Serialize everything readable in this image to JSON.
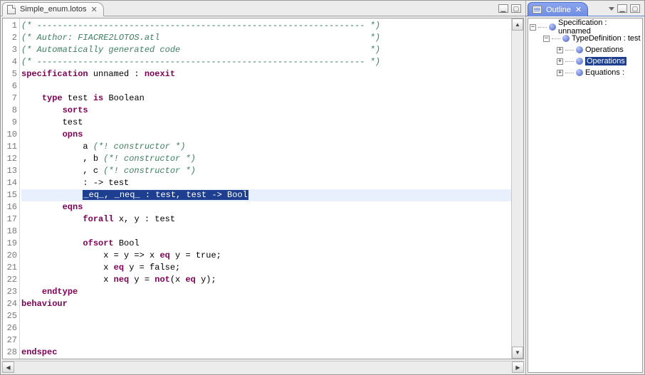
{
  "editor": {
    "tab_title": "Simple_enum.lotos",
    "lines": [
      {
        "n": 1,
        "type": "comment",
        "text": "(* ---------------------------------------------------------------- *)"
      },
      {
        "n": 2,
        "type": "comment",
        "text": "(* Author: FIACRE2LOTOS.atl                                         *)"
      },
      {
        "n": 3,
        "type": "comment",
        "text": "(* Automatically generated code                                     *)"
      },
      {
        "n": 4,
        "type": "comment",
        "text": "(* ---------------------------------------------------------------- *)"
      },
      {
        "n": 5,
        "type": "code",
        "segments": [
          {
            "t": "kw",
            "v": "specification"
          },
          {
            "t": "p",
            "v": " unnamed : "
          },
          {
            "t": "kw",
            "v": "noexit"
          }
        ]
      },
      {
        "n": 6,
        "type": "blank"
      },
      {
        "n": 7,
        "type": "code",
        "segments": [
          {
            "t": "p",
            "v": "    "
          },
          {
            "t": "kw",
            "v": "type"
          },
          {
            "t": "p",
            "v": " test "
          },
          {
            "t": "kw",
            "v": "is"
          },
          {
            "t": "p",
            "v": " Boolean"
          }
        ]
      },
      {
        "n": 8,
        "type": "code",
        "segments": [
          {
            "t": "p",
            "v": "        "
          },
          {
            "t": "kw",
            "v": "sorts"
          }
        ]
      },
      {
        "n": 9,
        "type": "code",
        "segments": [
          {
            "t": "p",
            "v": "        test"
          }
        ]
      },
      {
        "n": 10,
        "type": "code",
        "segments": [
          {
            "t": "p",
            "v": "        "
          },
          {
            "t": "kw",
            "v": "opns"
          }
        ]
      },
      {
        "n": 11,
        "type": "code",
        "segments": [
          {
            "t": "p",
            "v": "            a "
          },
          {
            "t": "cm",
            "v": "(*! constructor *)"
          }
        ]
      },
      {
        "n": 12,
        "type": "code",
        "segments": [
          {
            "t": "p",
            "v": "            , b "
          },
          {
            "t": "cm",
            "v": "(*! constructor *)"
          }
        ]
      },
      {
        "n": 13,
        "type": "code",
        "segments": [
          {
            "t": "p",
            "v": "            , c "
          },
          {
            "t": "cm",
            "v": "(*! constructor *)"
          }
        ]
      },
      {
        "n": 14,
        "type": "code",
        "segments": [
          {
            "t": "p",
            "v": "            : -> test"
          }
        ]
      },
      {
        "n": 15,
        "type": "code",
        "hl": true,
        "segments": [
          {
            "t": "p",
            "v": "            "
          },
          {
            "t": "sel",
            "v": "_eq_, _neq_ : test, test -> Bool"
          }
        ]
      },
      {
        "n": 16,
        "type": "code",
        "segments": [
          {
            "t": "p",
            "v": "        "
          },
          {
            "t": "kw",
            "v": "eqns"
          }
        ]
      },
      {
        "n": 17,
        "type": "code",
        "segments": [
          {
            "t": "p",
            "v": "            "
          },
          {
            "t": "kw",
            "v": "forall"
          },
          {
            "t": "p",
            "v": " x, y : test"
          }
        ]
      },
      {
        "n": 18,
        "type": "blank"
      },
      {
        "n": 19,
        "type": "code",
        "segments": [
          {
            "t": "p",
            "v": "            "
          },
          {
            "t": "kw",
            "v": "ofsort"
          },
          {
            "t": "p",
            "v": " Bool"
          }
        ]
      },
      {
        "n": 20,
        "type": "code",
        "segments": [
          {
            "t": "p",
            "v": "                x = y => x "
          },
          {
            "t": "kw",
            "v": "eq"
          },
          {
            "t": "p",
            "v": " y = true;"
          }
        ]
      },
      {
        "n": 21,
        "type": "code",
        "segments": [
          {
            "t": "p",
            "v": "                x "
          },
          {
            "t": "kw",
            "v": "eq"
          },
          {
            "t": "p",
            "v": " y = false;"
          }
        ]
      },
      {
        "n": 22,
        "type": "code",
        "segments": [
          {
            "t": "p",
            "v": "                x "
          },
          {
            "t": "kw",
            "v": "neq"
          },
          {
            "t": "p",
            "v": " y = "
          },
          {
            "t": "kw",
            "v": "not"
          },
          {
            "t": "p",
            "v": "(x "
          },
          {
            "t": "kw",
            "v": "eq"
          },
          {
            "t": "p",
            "v": " y);"
          }
        ]
      },
      {
        "n": 23,
        "type": "code",
        "segments": [
          {
            "t": "p",
            "v": "    "
          },
          {
            "t": "kw",
            "v": "endtype"
          }
        ]
      },
      {
        "n": 24,
        "type": "code",
        "segments": [
          {
            "t": "kw",
            "v": "behaviour"
          }
        ]
      },
      {
        "n": 25,
        "type": "blank"
      },
      {
        "n": 26,
        "type": "blank"
      },
      {
        "n": 27,
        "type": "blank"
      },
      {
        "n": 28,
        "type": "code",
        "segments": [
          {
            "t": "kw",
            "v": "endspec"
          }
        ]
      }
    ]
  },
  "outline": {
    "title": "Outline",
    "tree": [
      {
        "depth": 0,
        "exp": "-",
        "label": "Specification : unnamed",
        "selected": false
      },
      {
        "depth": 1,
        "exp": "-",
        "label": "TypeDefinition : test",
        "selected": false
      },
      {
        "depth": 2,
        "exp": "+",
        "label": "Operations",
        "selected": false
      },
      {
        "depth": 2,
        "exp": "+",
        "label": "Operations",
        "selected": true
      },
      {
        "depth": 2,
        "exp": "+",
        "label": "Equations :",
        "selected": false
      }
    ]
  }
}
